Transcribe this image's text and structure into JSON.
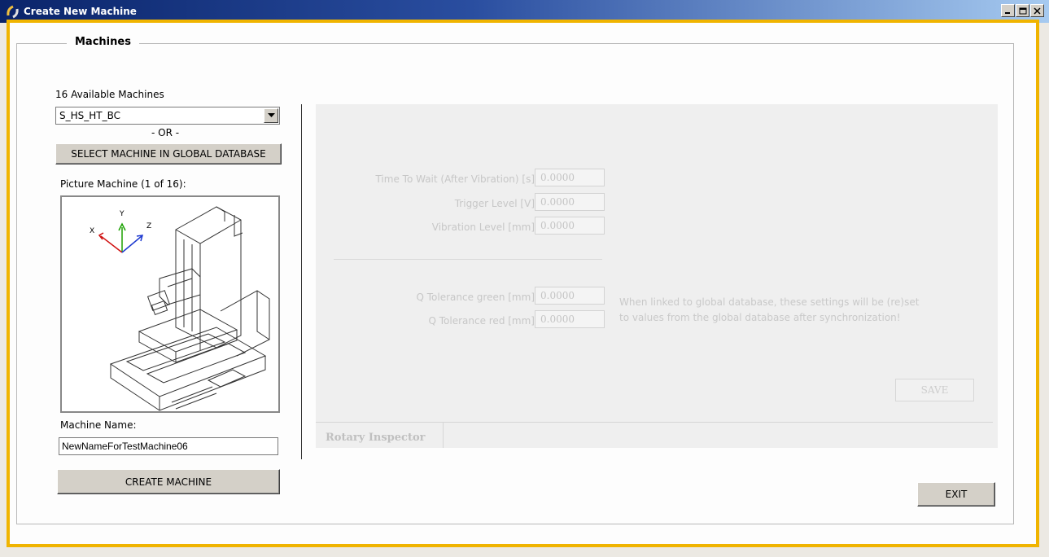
{
  "window": {
    "title": "Create New Machine",
    "controls": {
      "minimize": "_",
      "maximize": "□",
      "close": "X"
    }
  },
  "group": {
    "title": "Machines"
  },
  "machines": {
    "available_label": "16 Available Machines",
    "selected": "S_HS_HT_BC",
    "or_label": "- OR -",
    "global_db_button": "SELECT MACHINE IN GLOBAL DATABASE",
    "picture_label": "Picture Machine (1 of 16):",
    "axes": {
      "x": "X",
      "y": "Y",
      "z": "Z"
    },
    "name_label": "Machine Name:",
    "name_value": "NewNameForTestMachine06",
    "create_button": "CREATE MACHINE"
  },
  "settings": {
    "fields": [
      {
        "label": "Time To Wait (After Vibration) [s]",
        "value": "0.0000"
      },
      {
        "label": "Trigger Level [V]",
        "value": "0.0000"
      },
      {
        "label": "Vibration Level [mm]",
        "value": "0.0000"
      }
    ],
    "tolerances": [
      {
        "label": "Q Tolerance green [mm]",
        "value": "0.0000"
      },
      {
        "label": "Q Tolerance red [mm]",
        "value": "0.0000"
      }
    ],
    "note_line1": "When linked to global database, these settings will be (re)set",
    "note_line2": "to values from the global database after synchronization!",
    "save_button": "SAVE",
    "tab_label": "Rotary Inspector"
  },
  "exit_button": "EXIT",
  "colors": {
    "frame_accent": "#f0b400",
    "titlebar": "#0a246a",
    "disabled_text": "#c7c7c7"
  }
}
